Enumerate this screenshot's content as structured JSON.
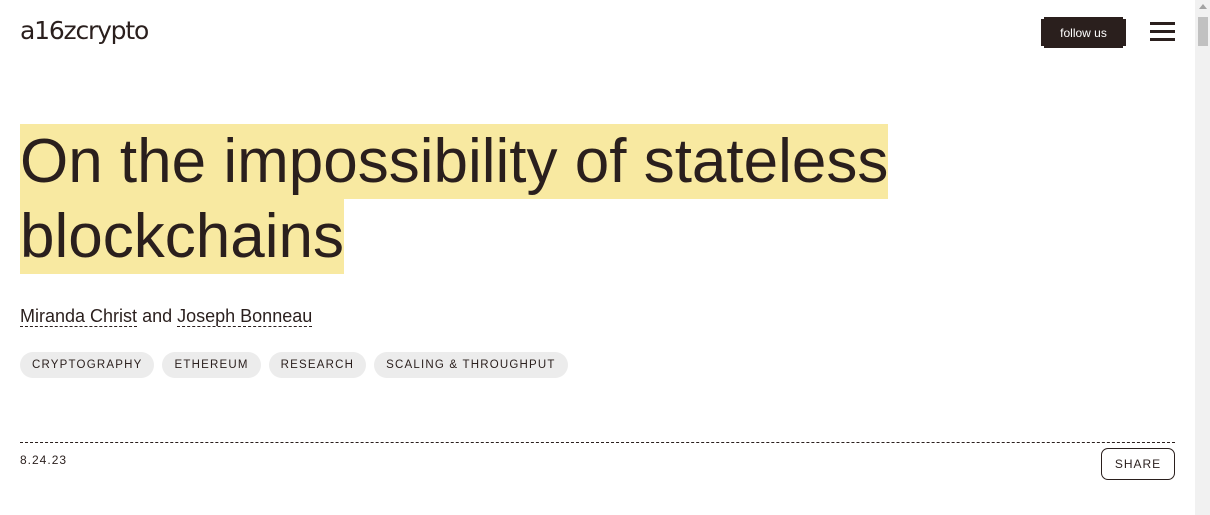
{
  "header": {
    "logo_text": "a16zcrypto",
    "follow_label": "follow us",
    "menu_icon": "hamburger-menu-icon"
  },
  "article": {
    "title": "On the impossibility of stateless blockchains",
    "authors": {
      "first": "Miranda Christ",
      "connector": "and",
      "second": "Joseph Bonneau"
    },
    "tags": [
      "CRYPTOGRAPHY",
      "ETHEREUM",
      "RESEARCH",
      "SCALING & THROUGHPUT"
    ],
    "date": "8.24.23",
    "share_label": "SHARE"
  },
  "colors": {
    "text": "#2a1f1d",
    "highlight": "#f8e9a1",
    "tag_bg": "#ececec"
  }
}
